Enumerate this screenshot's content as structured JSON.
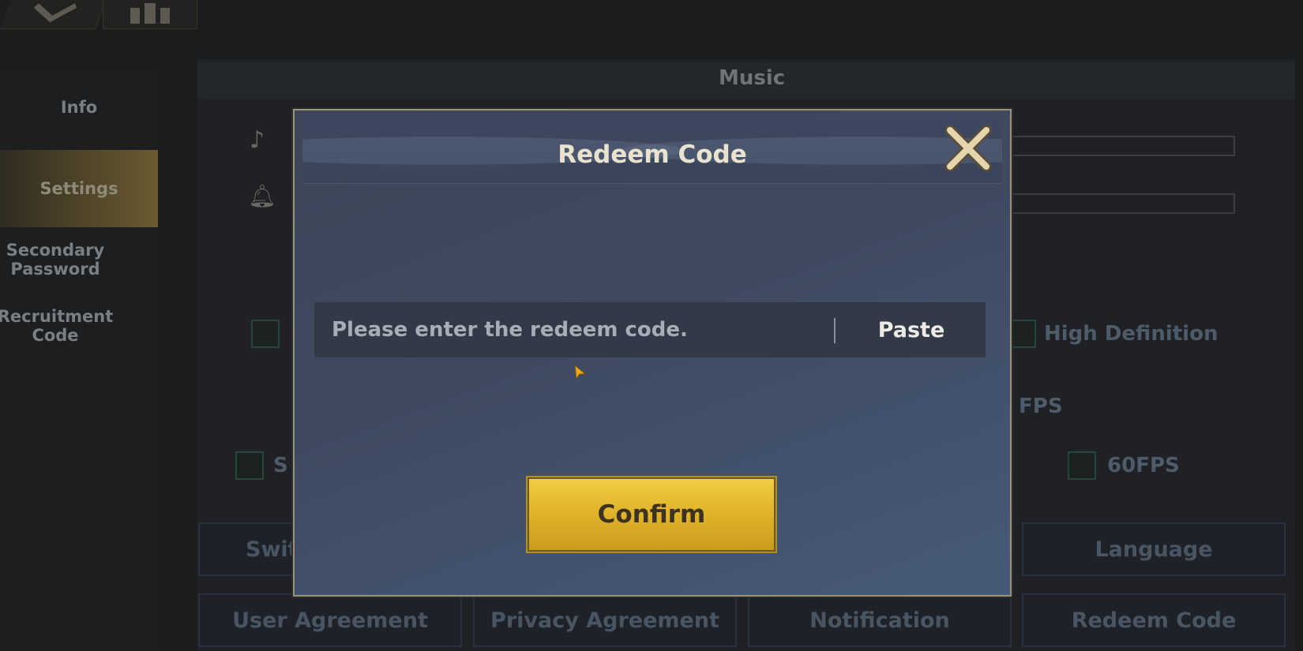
{
  "background": {
    "sidebar": {
      "items": [
        {
          "label": "Info"
        },
        {
          "label": "Settings"
        },
        {
          "label": "Secondary Password"
        },
        {
          "label": "Recruitment Code"
        }
      ],
      "active": "Settings"
    },
    "music_section": {
      "title": "Music"
    },
    "options": {
      "high_definition": "High Definition",
      "fps_title": "FPS",
      "fps_60": "60FPS",
      "partial_left_label": "S"
    },
    "buttons_row1": {
      "left_partial": "Swit",
      "language": "Language"
    },
    "buttons_row2": [
      {
        "label": "User Agreement"
      },
      {
        "label": "Privacy Agreement"
      },
      {
        "label": "Notification"
      },
      {
        "label": "Redeem Code"
      }
    ]
  },
  "modal": {
    "title": "Redeem Code",
    "input": {
      "value": "",
      "placeholder": "Please enter the redeem code."
    },
    "paste_label": "Paste",
    "confirm_label": "Confirm"
  },
  "colors": {
    "confirm_gold": "#e2b52a",
    "modal_bg": "#3f4a61",
    "title_text": "#e8e2cf"
  },
  "icons": [
    "music-note-icon",
    "bell-icon",
    "close-icon",
    "cursor-pointer-icon"
  ]
}
